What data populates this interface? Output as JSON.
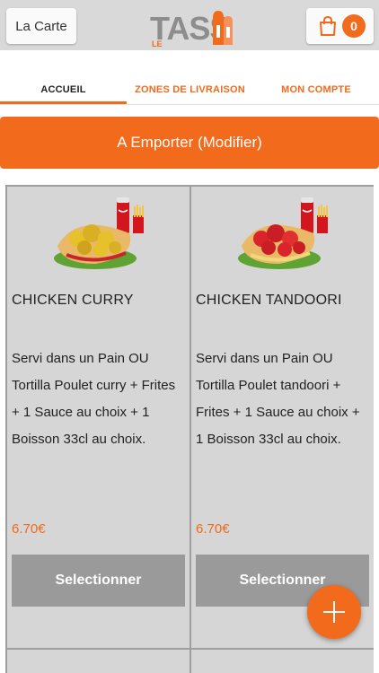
{
  "header": {
    "menu_button_label": "La Carte",
    "logo_text": "TASS",
    "logo_prefix": "LE",
    "cart_count": "0"
  },
  "tabs": [
    {
      "label": "ACCUEIL",
      "active": true
    },
    {
      "label": "ZONES DE LIVRAISON",
      "active": false
    },
    {
      "label": "MON COMPTE",
      "active": false
    }
  ],
  "order_mode": {
    "label": "A Emporter (Modifier)"
  },
  "products": [
    {
      "name": "CHICKEN CURRY",
      "description": "Servi dans un Pain OU Tortilla  Poulet curry  + Frites  + 1 Sauce au choix  + 1 Boisson 33cl au choix.",
      "price": "6.70€",
      "button_label": "Selectionner"
    },
    {
      "name": "CHICKEN TANDOORI",
      "description": "Servi dans un Pain OU Tortilla  Poulet tandoori + Frites  + 1 Sauce au choix  + 1 Boisson 33cl au choix.",
      "price": "6.70€",
      "button_label": "Selectionner"
    }
  ],
  "colors": {
    "accent": "#f26a1b",
    "card_bg": "#d6d6d6",
    "button_gray": "#9a9a9a"
  },
  "icons": {
    "cart": "shopping-bag-icon",
    "fab": "plus-icon"
  }
}
